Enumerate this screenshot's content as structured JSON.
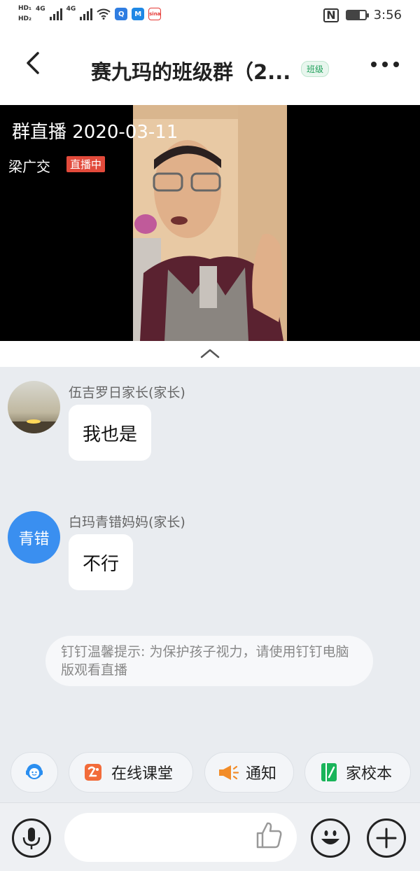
{
  "status_bar": {
    "hd1": "HD₁",
    "hd2": "HD₂",
    "net1": "4G",
    "net2": "4G",
    "time": "3:56",
    "battery_level": 0.7
  },
  "header": {
    "title": "赛九玛的班级群（2...",
    "badge": "班级"
  },
  "live": {
    "title": "群直播 2020-03-11",
    "host": "梁广交",
    "status": "直播中"
  },
  "messages": [
    {
      "sender": "伍吉罗日家长(家长)",
      "text": "我也是",
      "avatar_text": ""
    },
    {
      "sender": "白玛青错妈妈(家长)",
      "text": "不行",
      "avatar_text": "青错"
    }
  ],
  "system_tip": "钉钉温馨提示: 为保护孩子视力，请使用钉钉电脑版观看直播",
  "quick_actions": [
    {
      "label": "",
      "icon": "assistant-icon"
    },
    {
      "label": "在线课堂",
      "icon": "online-class-icon"
    },
    {
      "label": "通知",
      "icon": "megaphone-icon"
    },
    {
      "label": "家校本",
      "icon": "homework-book-icon"
    }
  ],
  "input": {
    "placeholder": ""
  },
  "colors": {
    "live_badge": "#e24a3b",
    "avatar_blue": "#3a8ff0",
    "class_badge": "#1fa05a",
    "megaphone": "#f28c28",
    "homework_green": "#19b45a",
    "online_class": "#f26b3a"
  }
}
